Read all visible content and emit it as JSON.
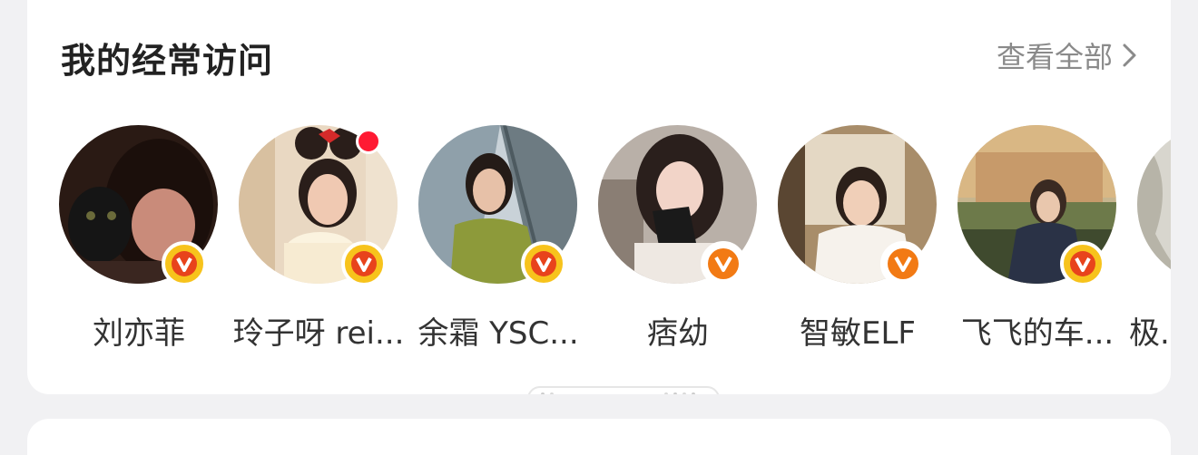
{
  "section": {
    "title": "我的经常访问",
    "view_all_label": "查看全部"
  },
  "users": [
    {
      "name": "刘亦菲",
      "badge": "gold-v",
      "has_dot": false
    },
    {
      "name": "玲子呀 rei...",
      "badge": "gold-v",
      "has_dot": true
    },
    {
      "name": "余霜 YSC...",
      "badge": "gold-v",
      "has_dot": false
    },
    {
      "name": "痞幼",
      "badge": "orange-v",
      "has_dot": false
    },
    {
      "name": "智敏ELF",
      "badge": "orange-v",
      "has_dot": false
    },
    {
      "name": "飞飞的车...",
      "badge": "gold-v",
      "has_dot": false
    },
    {
      "name": "极...",
      "badge": "none",
      "has_dot": false
    }
  ],
  "colors": {
    "gold_badge": "#f7c31c",
    "orange_badge": "#f27a14",
    "dot_red": "#ff1a33",
    "title_text": "#222222",
    "link_text": "#8a8a8a"
  },
  "icons": {
    "view_all": "chevron-right-icon",
    "verified": "verified-v-icon",
    "unread": "red-dot-icon"
  }
}
